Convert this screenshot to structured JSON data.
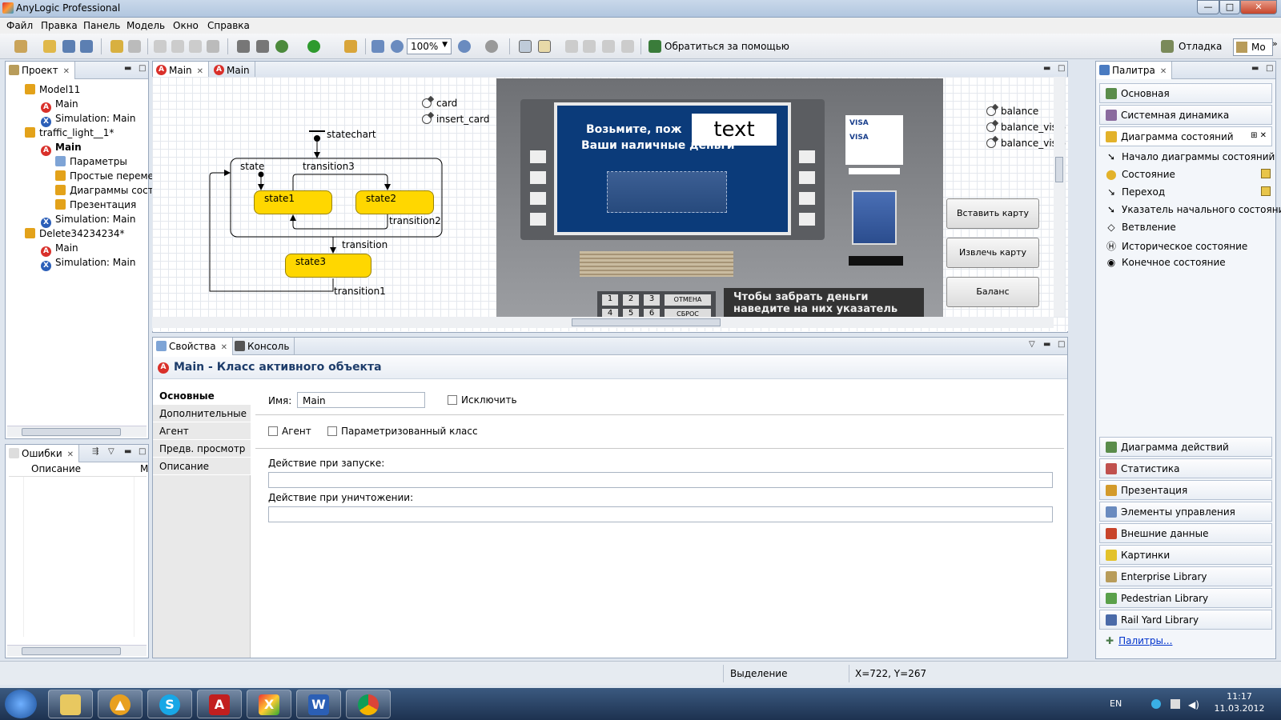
{
  "window": {
    "title": "AnyLogic Professional",
    "btn_min": "—",
    "btn_max": "□",
    "btn_close": "✕"
  },
  "menu": [
    "Файл",
    "Правка",
    "Панель",
    "Модель",
    "Окно",
    "Справка"
  ],
  "toolbar": {
    "zoom": "100%",
    "help": "Обратиться за помощью",
    "debug": "Отладка",
    "model": "Mo",
    "more": "»"
  },
  "project_panel": {
    "tab": "Проект",
    "tree": [
      {
        "label": "Model11",
        "icon": "model-icon"
      },
      {
        "label": "Main",
        "icon": "active-object-icon"
      },
      {
        "label": "Simulation: Main",
        "icon": "experiment-icon"
      },
      {
        "label": "traffic_light__1*",
        "icon": "model-icon"
      },
      {
        "label": "Main",
        "icon": "active-object-icon"
      },
      {
        "label": "Параметры",
        "icon": "parameters-icon"
      },
      {
        "label": "Простые переме",
        "icon": "variables-icon"
      },
      {
        "label": "Диаграммы сост",
        "icon": "statecharts-icon"
      },
      {
        "label": "Презентация",
        "icon": "presentation-icon"
      },
      {
        "label": "Simulation: Main",
        "icon": "experiment-icon"
      },
      {
        "label": "Delete34234234*",
        "icon": "model-icon"
      },
      {
        "label": "Main",
        "icon": "active-object-icon"
      },
      {
        "label": "Simulation: Main",
        "icon": "experiment-icon"
      }
    ]
  },
  "errors_panel": {
    "tab": "Ошибки",
    "col_desc": "Описание",
    "col_m": "М"
  },
  "editor": {
    "tabs": [
      "Main",
      "Main"
    ],
    "diagram": {
      "statechart": "statechart",
      "state": "state",
      "transition3": "transition3",
      "state1": "state1",
      "state2": "state2",
      "transition2": "transition2",
      "transition": "transition",
      "state3": "state3",
      "transition1": "transition1",
      "vars_left": [
        "card",
        "insert_card"
      ],
      "vars_right": [
        "balance",
        "balance_visib",
        "balance_visib"
      ]
    },
    "atm": {
      "screen_line1": "Возьмите, пож",
      "screen_line2": "Ваши наличные деньги",
      "text_box": "text",
      "hint_line1": "Чтобы забрать деньги",
      "hint_line2": "наведите на них указатель",
      "keys": [
        "1",
        "2",
        "3",
        "ОТМЕНА",
        "4",
        "5",
        "6",
        "СБРОС"
      ],
      "cards": [
        "VISA",
        "VISA"
      ]
    },
    "buttons": [
      "Вставить карту",
      "Извлечь карту",
      "Баланс"
    ]
  },
  "properties": {
    "tabs": [
      "Свойства",
      "Консоль"
    ],
    "title": "Main - Класс активного объекта",
    "nav": [
      "Основные",
      "Дополнительные",
      "Агент",
      "Предв. просмотр",
      "Описание"
    ],
    "name_label": "Имя:",
    "name_value": "Main",
    "exclude": "Исключить",
    "agent": "Агент",
    "parametrized": "Параметризованный класс",
    "on_startup": "Действие при запуске:",
    "on_destroy": "Действие при уничтожении:"
  },
  "palette": {
    "tab": "Палитра",
    "top_sections": [
      "Основная",
      "Системная динамика",
      "Диаграмма состояний"
    ],
    "items": [
      "Начало диаграммы состояний",
      "Состояние",
      "Переход",
      "Указатель начального состояния",
      "Ветвление",
      "Историческое состояние",
      "Конечное состояние"
    ],
    "bottom_sections": [
      "Диаграмма действий",
      "Статистика",
      "Презентация",
      "Элементы управления",
      "Внешние данные",
      "Картинки",
      "Enterprise Library",
      "Pedestrian Library",
      "Rail Yard Library"
    ],
    "more_link": "Палитры..."
  },
  "statusbar": {
    "mode": "Выделение",
    "coords": "X=722, Y=267"
  },
  "taskbar": {
    "lang": "EN",
    "time": "11:17",
    "date": "11.03.2012"
  },
  "colors": {
    "state_fill": "#ffd700",
    "atm_screen": "#0b3b7a",
    "accent": "#2c5fb8"
  }
}
